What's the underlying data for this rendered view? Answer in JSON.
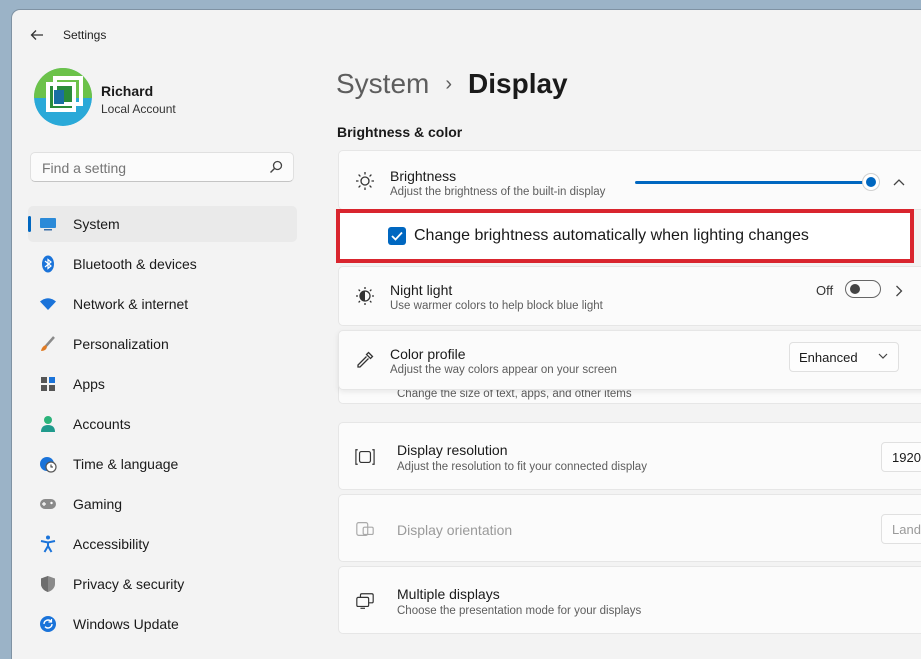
{
  "window": {
    "title": "Settings"
  },
  "user": {
    "name": "Richard",
    "account_type": "Local Account"
  },
  "search": {
    "placeholder": "Find a setting"
  },
  "sidebar": {
    "items": [
      {
        "label": "System",
        "icon": "system-icon",
        "active": true
      },
      {
        "label": "Bluetooth & devices",
        "icon": "bluetooth-icon"
      },
      {
        "label": "Network & internet",
        "icon": "wifi-icon"
      },
      {
        "label": "Personalization",
        "icon": "brush-icon"
      },
      {
        "label": "Apps",
        "icon": "apps-icon"
      },
      {
        "label": "Accounts",
        "icon": "person-icon"
      },
      {
        "label": "Time & language",
        "icon": "clock-globe-icon"
      },
      {
        "label": "Gaming",
        "icon": "gamepad-icon"
      },
      {
        "label": "Accessibility",
        "icon": "accessibility-icon"
      },
      {
        "label": "Privacy & security",
        "icon": "shield-icon"
      },
      {
        "label": "Windows Update",
        "icon": "update-icon"
      }
    ]
  },
  "breadcrumb": {
    "parent": "System",
    "current": "Display"
  },
  "section": {
    "brightness_color": "Brightness & color"
  },
  "brightness": {
    "title": "Brightness",
    "subtitle": "Adjust the brightness of the built-in display",
    "level_percent": 100,
    "auto_label": "Change brightness automatically when lighting changes",
    "auto_checked": true
  },
  "night_light": {
    "title": "Night light",
    "subtitle": "Use warmer colors to help block blue light",
    "state": "Off"
  },
  "color_profile": {
    "title": "Color profile",
    "subtitle": "Adjust the way colors appear on your screen",
    "value": "Enhanced"
  },
  "scale": {
    "subtitle": "Change the size of text, apps, and other items"
  },
  "resolution": {
    "title": "Display resolution",
    "subtitle": "Adjust the resolution to fit your connected display",
    "value": "1920"
  },
  "orientation": {
    "title": "Display orientation",
    "value": "Land"
  },
  "multiple": {
    "title": "Multiple displays",
    "subtitle": "Choose the presentation mode for your displays"
  },
  "colors": {
    "accent": "#0067c0",
    "highlight": "#d9252e"
  }
}
